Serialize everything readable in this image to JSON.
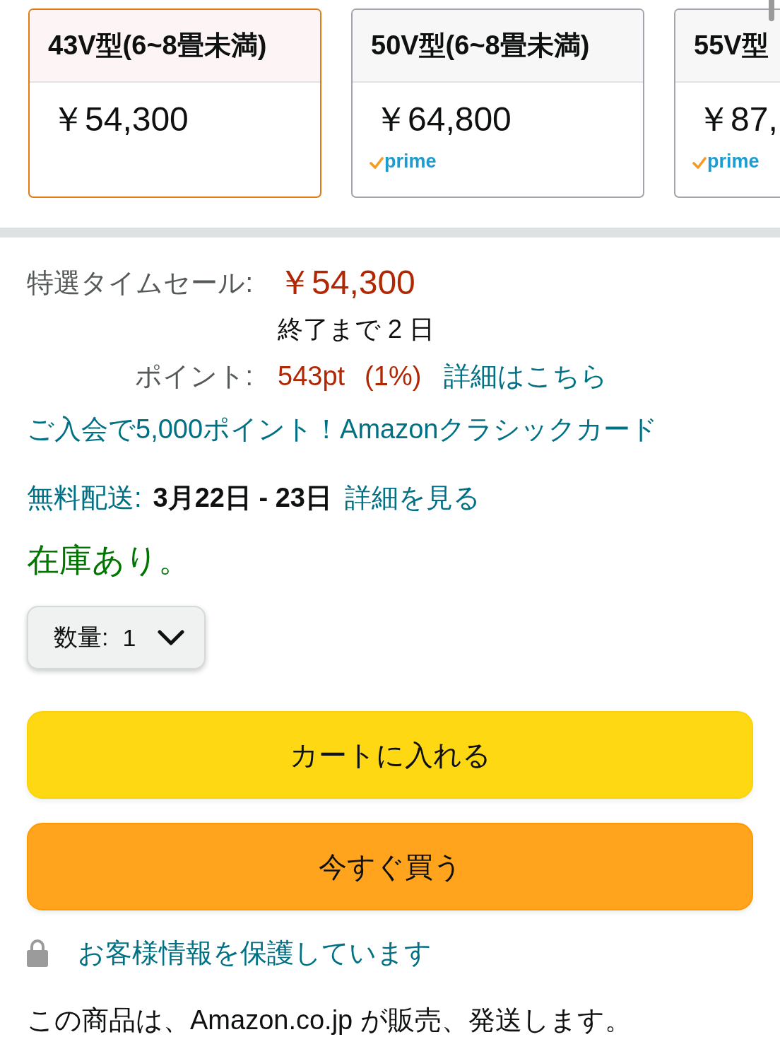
{
  "variant_cards": [
    {
      "label": "43V型(6~8畳未満)",
      "price": "￥54,300",
      "selected": true
    },
    {
      "label": "50V型(6~8畳未満)",
      "price": "￥64,800",
      "badge": "prime",
      "selected": false
    },
    {
      "label": "55V型",
      "price": "￥87,",
      "badge": "prime",
      "selected": false
    }
  ],
  "deal": {
    "label": "特選タイムセール:",
    "price": "￥54,300",
    "countdown": "終了まで 2 日"
  },
  "points": {
    "label": "ポイント:",
    "value": "543pt",
    "percent": "(1%)",
    "link": "詳細はこちら"
  },
  "card_offer": {
    "link": "ご入会で5,000ポイント！Amazonクラシックカード"
  },
  "delivery": {
    "label": "無料配送:",
    "dates": "3月22日 - 23日",
    "link": "詳細を見る"
  },
  "availability": {
    "text": "在庫あり。",
    "in_stock": true
  },
  "quantity": {
    "label": "数量:",
    "value": "1"
  },
  "buttons": [
    {
      "kind": "add_to_cart",
      "label": "カートに入れる"
    },
    {
      "kind": "buy_now",
      "label": "今すぐ買う"
    }
  ],
  "secure_note": {
    "link": "お客様情報を保護しています"
  },
  "seller_note": "この商品は、Amazon.co.jp が販売、発送します。"
}
